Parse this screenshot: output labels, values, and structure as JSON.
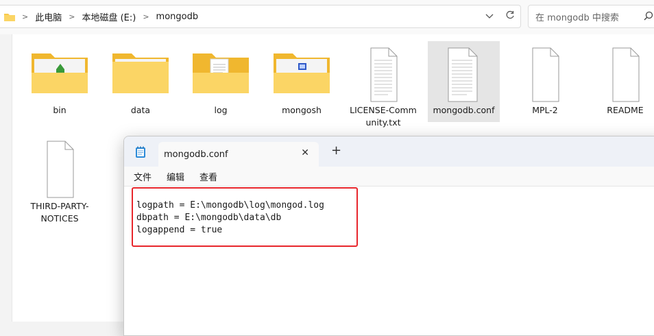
{
  "address_bar": {
    "crumbs": [
      "此电脑",
      "本地磁盘 (E:)",
      "mongodb"
    ],
    "separator": ">",
    "dropdown_icon": "chevron-down-icon",
    "refresh_icon": "refresh-icon"
  },
  "search": {
    "placeholder": "在 mongodb 中搜索"
  },
  "files": [
    {
      "name": "bin",
      "type": "folder",
      "badge": "green-arrow"
    },
    {
      "name": "data",
      "type": "folder"
    },
    {
      "name": "log",
      "type": "folder",
      "badge": "document"
    },
    {
      "name": "mongosh",
      "type": "folder",
      "badge": "blue-window"
    },
    {
      "name": "LICENSE-Comm",
      "name2": "unity.txt",
      "type": "text-file"
    },
    {
      "name": "mongodb.conf",
      "type": "text-file",
      "selected": true
    },
    {
      "name": "MPL-2",
      "type": "blank-file"
    },
    {
      "name": "README",
      "type": "blank-file"
    },
    {
      "name": "THIRD-PARTY-",
      "name2": "NOTICES",
      "type": "blank-file"
    }
  ],
  "notepad": {
    "tab_title": "mongodb.conf",
    "close_glyph": "✕",
    "new_tab_glyph": "+",
    "menu": [
      "文件",
      "编辑",
      "查看"
    ],
    "lines": [
      "logpath = E:\\mongodb\\log\\mongod.log",
      "dbpath = E:\\mongodb\\data\\db",
      "logappend = true"
    ]
  },
  "colors": {
    "highlight": "#e8262c",
    "folder": "#f8c94a",
    "accent": "#0067c0"
  }
}
